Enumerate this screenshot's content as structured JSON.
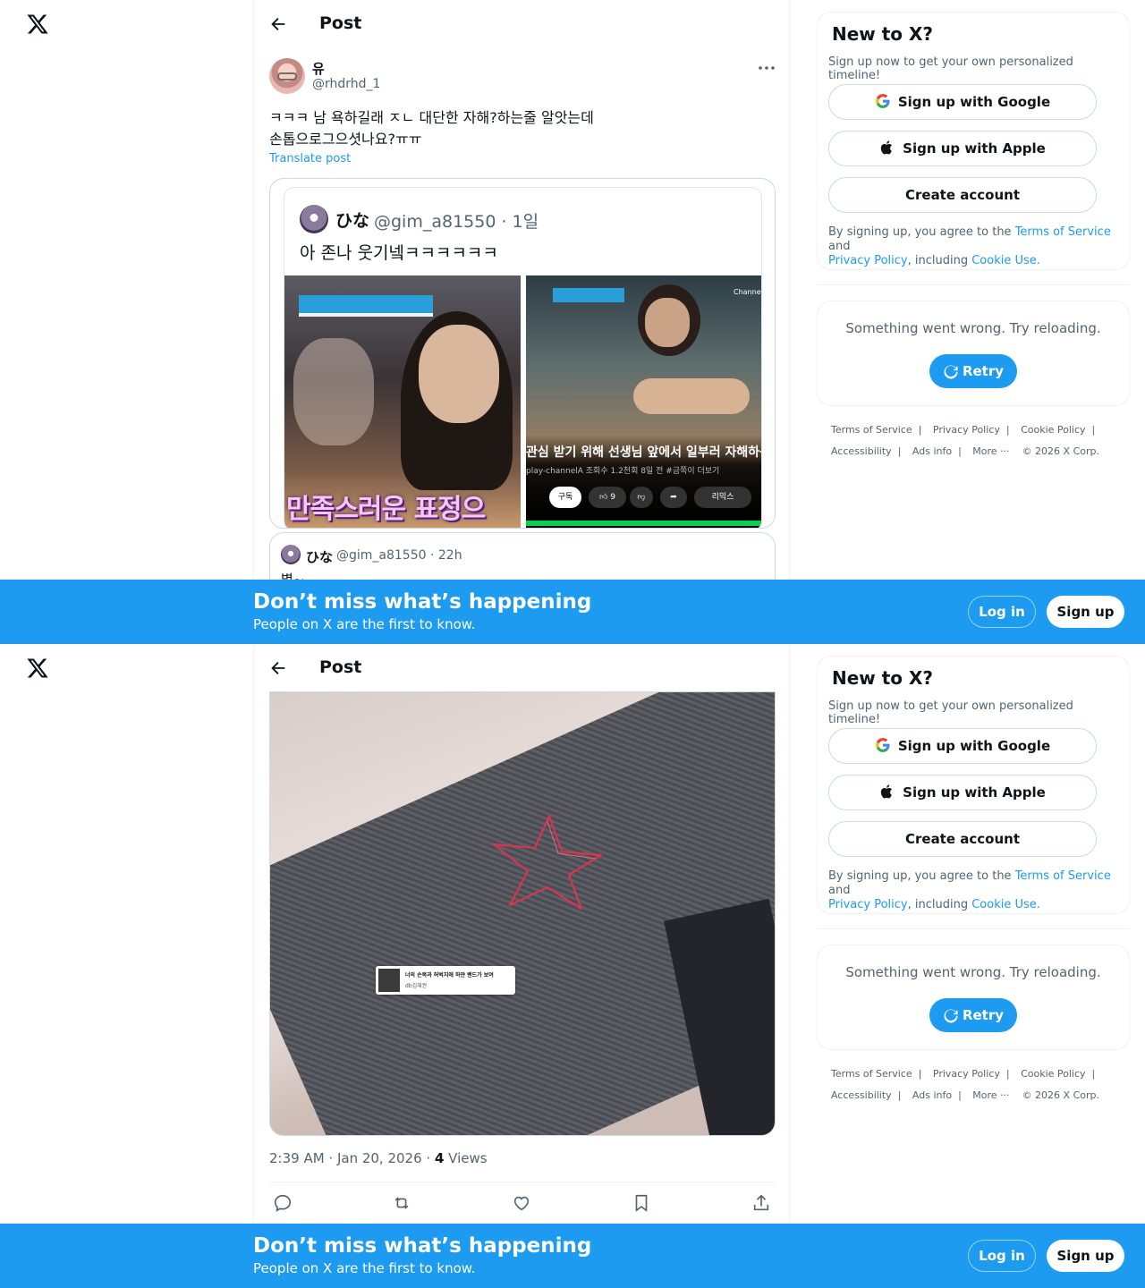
{
  "brand": {
    "accent": "#1d9bf0",
    "text": "#0f1419",
    "muted": "#536471",
    "border": "#cfd9de"
  },
  "header": {
    "title": "Post",
    "back_icon": "arrow-left-icon"
  },
  "post": {
    "author_name": "유",
    "author_handle": "@rhdrhd_1",
    "text": "ㅋㅋㅋ 남 욕하길래 ㅈㄴ 대단한 자해?하는줄 알앗는데\n손톱으로그으셧나요?ㅠㅠ",
    "translate_label": "Translate post",
    "timestamp": "2:39 AM · Jan 20, 2026 · ",
    "views_count": "4",
    "views_label": " Views"
  },
  "embedded_screenshot": {
    "name": "ひな",
    "handle": "@gim_a81550 · 1일",
    "text": "아 존나 웃기넼ㅋㅋㅋㅋㅋㅋ",
    "left_caption": "만족스러운 표정으",
    "video_title": "관심 받기 위해 선생님 앞에서 일부러 자해하는..",
    "video_meta": "play-channelA 조회수 1.2천회 8일 전 #금쪽이 더보기",
    "subscribe_label": "구독",
    "like_count": "9",
    "remix_label": "리믹스",
    "channel_label": "Channel"
  },
  "quoted": {
    "name": "ひな",
    "handle": "@gim_a81550 · 22h",
    "text": "별~"
  },
  "image_sticker": {
    "line1": "너의 손목과 허벅지에 하얀 밴드가 보여",
    "line2": "db김재권"
  },
  "sidebar": {
    "new_title": "New to X?",
    "new_sub": "Sign up now to get your own personalized timeline!",
    "google_label": "Sign up with Google",
    "apple_label": "Sign up with Apple",
    "create_label": "Create account",
    "legal_pre": "By signing up, you agree to the ",
    "terms_link": "Terms of Service",
    "legal_and": " and",
    "privacy_link": "Privacy Policy",
    "legal_mid": ", including ",
    "cookie_link": "Cookie Use.",
    "error_text": "Something went wrong. Try reloading.",
    "retry_label": "Retry"
  },
  "footer": {
    "terms": "Terms of Service",
    "privacy": "Privacy Policy",
    "cookie": "Cookie Policy",
    "accessibility": "Accessibility",
    "ads": "Ads info",
    "more": "More ···",
    "copyright": "© 2026 X Corp.",
    "sep": "|"
  },
  "banner": {
    "title": "Don’t miss what’s happening",
    "subtitle": "People on X are the first to know.",
    "login_label": "Log in",
    "signup_label": "Sign up"
  }
}
